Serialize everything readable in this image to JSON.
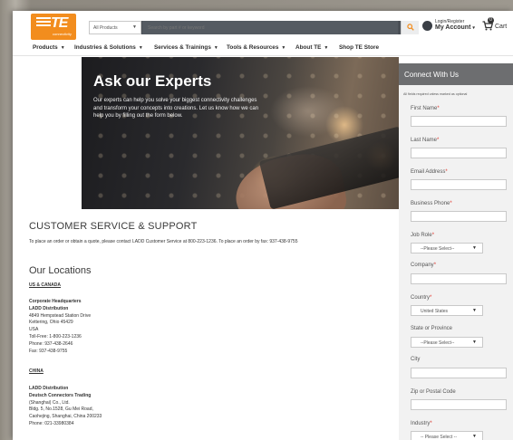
{
  "header": {
    "logo_text": "TE",
    "logo_sub": "connectivity",
    "search_category": "All Products",
    "search_placeholder": "Search by part # or keyword",
    "account_line1": "Login/Register",
    "account_line2": "My Account",
    "cart_count": "0",
    "cart_label": "Cart"
  },
  "nav": {
    "items": [
      {
        "label": "Products"
      },
      {
        "label": "Industries & Solutions"
      },
      {
        "label": "Services & Trainings"
      },
      {
        "label": "Tools & Resources"
      },
      {
        "label": "About TE"
      },
      {
        "label": "Shop TE Store"
      }
    ]
  },
  "hero": {
    "title": "Ask our Experts",
    "text": "Our experts can help you solve your biggest connectivity challenges and transform your concepts into creations. Let us know how we can help you by filling out the form below."
  },
  "main": {
    "cs_title": "CUSTOMER SERVICE & SUPPORT",
    "cs_text": "To place an order or obtain a quote, please contact LADD Customer Service at 800-223-1236. To place an order by fax: 937-438-9755",
    "locations_title": "Our Locations",
    "us": {
      "region": "US & CANADA",
      "hq": "Corporate Headquarters",
      "company": "LADD Distribution",
      "line1": "4849 Hempstead Station Drive",
      "line2": "Kettering, Ohio 45429",
      "line3": "USA",
      "line4": "Toll-Free: 1-800-223-1236",
      "line5": "Phone: 937-438-2646",
      "line6": "Fax: 937-438-9755"
    },
    "china": {
      "region": "CHINA",
      "company": "LADD Distribution",
      "sub": "Deutsch Connectors Trading",
      "line1": "(Shanghai) Co., Ltd.",
      "line2": "Bldg. 5, No.1528, Gu Mei Road,",
      "line3": "Caohejing, Shanghai, China 200233",
      "line4": "Phone: 021-33980384"
    }
  },
  "form": {
    "title": "Connect With Us",
    "note": "All fields required unless marked as optional",
    "first_name": "First Name",
    "last_name": "Last Name",
    "email": "Email Address",
    "phone": "Business Phone",
    "job_role": "Job Role",
    "job_role_value": "--Please Select--",
    "company": "Company",
    "country": "Country",
    "country_value": "United States",
    "state": "State or Province",
    "state_value": "--Please Select--",
    "city": "City",
    "zip": "Zip or Postal Code",
    "industry": "Industry",
    "industry_value": "-- Please Select --",
    "required_mark": "*"
  }
}
